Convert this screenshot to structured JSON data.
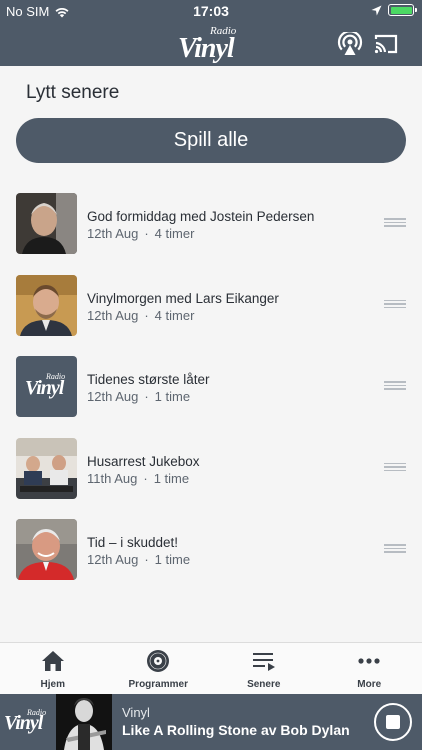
{
  "status": {
    "carrier": "No SIM",
    "time": "17:03",
    "wifi_icon": "wifi-icon",
    "location_icon": "location-arrow-icon",
    "battery_icon": "battery-full-icon"
  },
  "header": {
    "logo_small": "Radio",
    "logo_big": "Vinyl",
    "airplay_icon": "airplay-icon",
    "cast_icon": "cast-icon"
  },
  "page": {
    "title": "Lytt senere",
    "play_all": "Spill alle"
  },
  "items": [
    {
      "title": "God formiddag med Jostein Pedersen",
      "date": "12th Aug",
      "sep": "·",
      "duration": "4 timer"
    },
    {
      "title": "Vinylmorgen med Lars Eikanger",
      "date": "12th Aug",
      "sep": "·",
      "duration": "4 timer"
    },
    {
      "title": "Tidenes største låter",
      "date": "12th Aug",
      "sep": "·",
      "duration": "1 time",
      "thumb_logo_small": "Radio",
      "thumb_logo_big": "Vinyl"
    },
    {
      "title": "Husarrest Jukebox",
      "date": "11th Aug",
      "sep": "·",
      "duration": "1 time"
    },
    {
      "title": "Tid – i skuddet!",
      "date": "12th Aug",
      "sep": "·",
      "duration": "1 time"
    }
  ],
  "tabs": [
    {
      "label": "Hjem",
      "icon": "home-icon"
    },
    {
      "label": "Programmer",
      "icon": "vinyl-record-icon"
    },
    {
      "label": "Senere",
      "icon": "playlist-icon"
    },
    {
      "label": "More",
      "icon": "more-dots-icon"
    }
  ],
  "player": {
    "logo_small": "Radio",
    "logo_big": "Vinyl",
    "station": "Vinyl",
    "track": "Like A Rolling Stone av Bob Dylan",
    "stop_icon": "stop-icon"
  },
  "colors": {
    "primary": "#4e5a68",
    "background": "#f5f5f5",
    "battery": "#4cd964"
  }
}
